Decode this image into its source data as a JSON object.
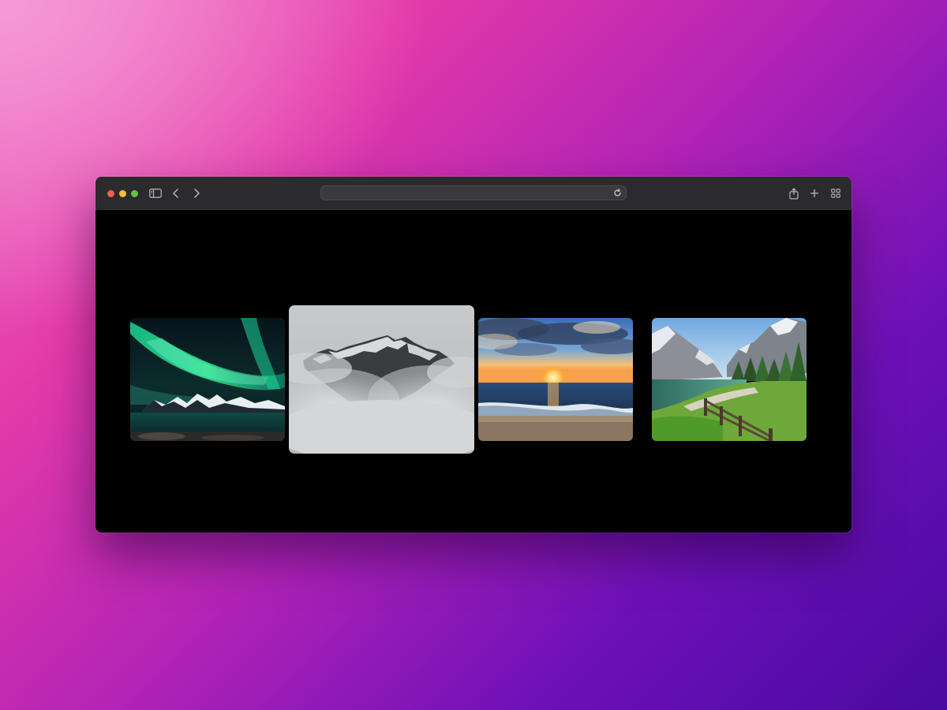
{
  "browser": {
    "address_bar": {
      "url": ""
    },
    "toolbar_icons": [
      "sidebar-icon",
      "back-icon",
      "forward-icon",
      "reload-icon",
      "share-icon",
      "new-tab-icon",
      "tab-overview-icon"
    ]
  },
  "gallery": {
    "images": [
      {
        "subject": "aurora-borealis-mountains"
      },
      {
        "subject": "foggy-mountain-peak"
      },
      {
        "subject": "ocean-sunset-beach"
      },
      {
        "subject": "alpine-lake-meadow"
      }
    ],
    "focused_index": 1
  },
  "colors": {
    "window_chrome": "#2b2a2c",
    "content_background": "#000000",
    "traffic_red": "#ee5f55",
    "traffic_yellow": "#f4bd37",
    "traffic_green": "#5ec445"
  }
}
